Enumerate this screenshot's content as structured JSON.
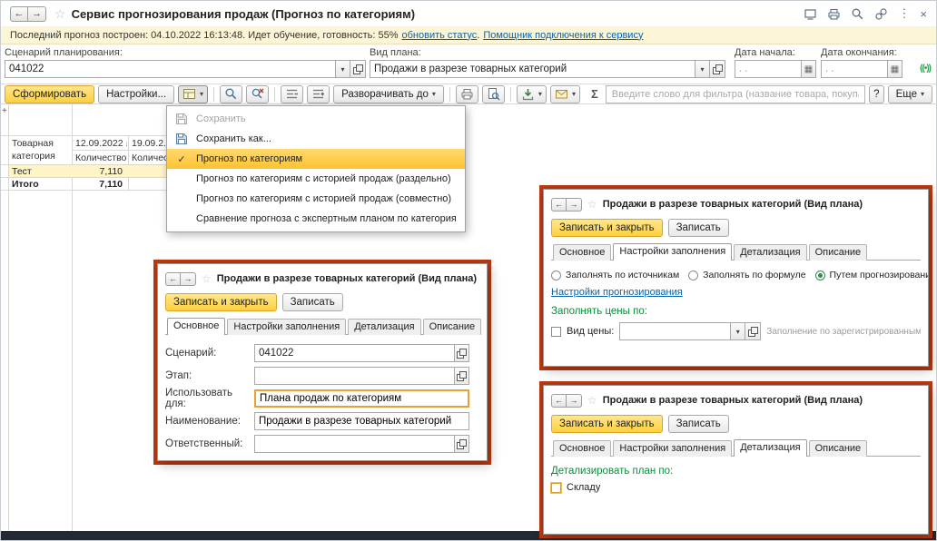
{
  "glyphs": {
    "back": "←",
    "forward": "→",
    "star": "☆",
    "dropdown": "▾",
    "kebab": "⋮",
    "close": "×",
    "plus": "+",
    "calendar": "▦",
    "check": "✓",
    "discussion": "((•))"
  },
  "titlebar": {
    "title": "Сервис прогнозирования продаж (Прогноз по категориям)"
  },
  "statusbar": {
    "text": "Последний прогноз построен: 04.10.2022 16:13:48. Идет обучение, готовность: 55%",
    "refresh_link": "обновить статус",
    "suffix": ".",
    "assistant_link": "Помощник подключения к сервису"
  },
  "filters": {
    "scenario": {
      "label": "Сценарий планирования:",
      "value": "041022"
    },
    "plan": {
      "label": "Вид плана:",
      "value": "Продажи в разрезе товарных категорий"
    },
    "date_start": {
      "label": "Дата начала:",
      "value": ". ."
    },
    "date_end": {
      "label": "Дата окончания:",
      "value": ". ."
    }
  },
  "toolbar": {
    "generate": "Сформировать",
    "settings": "Настройки...",
    "expand_to": "Разворачивать до",
    "sigma": "Σ",
    "filter_placeholder": "Введите слово для фильтра (название товара, покупателя и пр.)",
    "help": "?",
    "more": "Еще"
  },
  "variant_menu": {
    "selected_index": 2,
    "disabled_index": 0,
    "items": [
      {
        "label": "Сохранить"
      },
      {
        "label": "Сохранить как..."
      },
      {
        "label": "Прогноз по категориям"
      },
      {
        "label": "Прогноз по категориям с историей продаж (раздельно)"
      },
      {
        "label": "Прогноз по категориям с историей продаж (совместно)"
      },
      {
        "label": "Сравнение прогноза с экспертным планом по категориям"
      }
    ]
  },
  "table": {
    "headers": {
      "category": "Товарная категория",
      "date1": "12.09.2022",
      "sort1": "↓",
      "qty1": "Количество",
      "date2": "19.09.2...",
      "qty2": "Количест..."
    },
    "rows": [
      {
        "name": "Тест",
        "qty1": "7,110"
      },
      {
        "name": "Итого",
        "qty1": "7,110"
      }
    ]
  },
  "dialog_main": {
    "title": "Продажи в разрезе товарных категорий (Вид плана)",
    "save_close": "Записать и закрыть",
    "save": "Записать",
    "tabs": [
      "Основное",
      "Настройки заполнения",
      "Детализация",
      "Описание"
    ],
    "active_tab": 0,
    "fields": [
      {
        "label": "Сценарий:",
        "value": "041022"
      },
      {
        "label": "Этап:",
        "value": ""
      },
      {
        "label": "Использовать для:",
        "value": "Плана продаж по категориям"
      },
      {
        "label": "Наименование:",
        "value": "Продажи в разрезе товарных категорий"
      },
      {
        "label": "Ответственный:",
        "value": ""
      }
    ]
  },
  "dialog_fill": {
    "title": "Продажи в разрезе товарных категорий (Вид плана)",
    "save_close": "Записать и закрыть",
    "save": "Записать",
    "tabs": [
      "Основное",
      "Настройки заполнения",
      "Детализация",
      "Описание"
    ],
    "active_tab": 1,
    "radios": [
      {
        "label": "Заполнять по источникам",
        "selected": false
      },
      {
        "label": "Заполнять по формуле",
        "selected": false
      },
      {
        "label": "Путем прогнозирования",
        "selected": true
      }
    ],
    "settings_link": "Настройки прогнозирования",
    "prices_label": "Заполнять цены по:",
    "price_kind_label": "Вид цены:",
    "price_kind_value": "",
    "price_hint": "Заполнение по зарегистрированным ценам компании."
  },
  "dialog_detail": {
    "title": "Продажи в разрезе товарных категорий (Вид плана)",
    "save_close": "Записать и закрыть",
    "save": "Записать",
    "tabs": [
      "Основное",
      "Настройки заполнения",
      "Детализация",
      "Описание"
    ],
    "active_tab": 2,
    "detail_label": "Детализировать план по:",
    "warehouse_label": "Складу",
    "warehouse_checked": false
  }
}
